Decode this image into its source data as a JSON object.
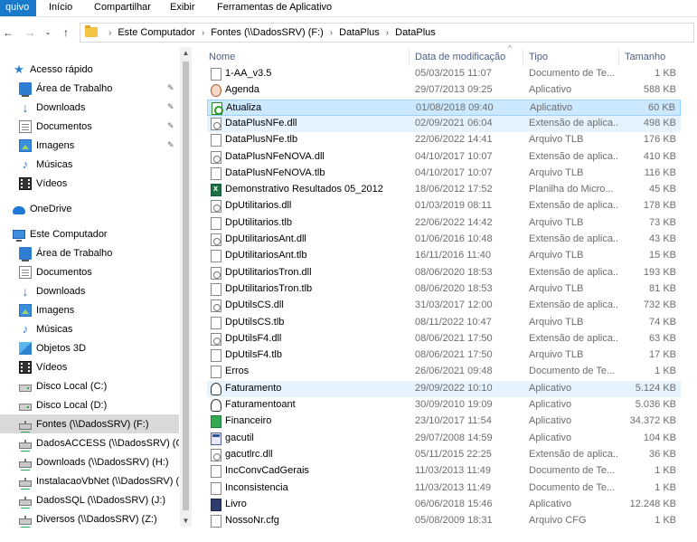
{
  "ribbon": {
    "file_tab": "quivo",
    "tabs": [
      "Início",
      "Compartilhar",
      "Exibir",
      "Ferramentas de Aplicativo"
    ]
  },
  "address": {
    "crumbs": [
      "Este Computador",
      "Fontes (\\\\DadosSRV) (F:)",
      "DataPlus",
      "DataPlus"
    ]
  },
  "nav": {
    "items": [
      {
        "label": "Acesso rápido",
        "icon": "star-icon",
        "indent": 0,
        "pinned": false
      },
      {
        "label": "Área de Trabalho",
        "icon": "desktop-icon",
        "indent": 1,
        "pinned": true
      },
      {
        "label": "Downloads",
        "icon": "download-icon",
        "indent": 1,
        "pinned": true
      },
      {
        "label": "Documentos",
        "icon": "documents-icon",
        "indent": 1,
        "pinned": true
      },
      {
        "label": "Imagens",
        "icon": "pictures-icon",
        "indent": 1,
        "pinned": true
      },
      {
        "label": "Músicas",
        "icon": "music-icon",
        "indent": 1,
        "pinned": false
      },
      {
        "label": "Vídeos",
        "icon": "videos-icon",
        "indent": 1,
        "pinned": false
      },
      {
        "label": "OneDrive",
        "icon": "cloud-icon",
        "indent": 0,
        "pinned": false
      },
      {
        "label": "Este Computador",
        "icon": "computer-icon",
        "indent": 0,
        "pinned": false
      },
      {
        "label": "Área de Trabalho",
        "icon": "desktop-icon",
        "indent": 1,
        "pinned": false
      },
      {
        "label": "Documentos",
        "icon": "documents-icon",
        "indent": 1,
        "pinned": false
      },
      {
        "label": "Downloads",
        "icon": "download-icon",
        "indent": 1,
        "pinned": false
      },
      {
        "label": "Imagens",
        "icon": "pictures-icon",
        "indent": 1,
        "pinned": false
      },
      {
        "label": "Músicas",
        "icon": "music-icon",
        "indent": 1,
        "pinned": false
      },
      {
        "label": "Objetos 3D",
        "icon": "3d-objects-icon",
        "indent": 1,
        "pinned": false
      },
      {
        "label": "Vídeos",
        "icon": "videos-icon",
        "indent": 1,
        "pinned": false
      },
      {
        "label": "Disco Local (C:)",
        "icon": "local-disk-icon",
        "indent": 1,
        "pinned": false
      },
      {
        "label": "Disco Local (D:)",
        "icon": "local-disk-icon",
        "indent": 1,
        "pinned": false
      },
      {
        "label": "Fontes (\\\\DadosSRV) (F:)",
        "icon": "network-drive-icon",
        "indent": 1,
        "pinned": false,
        "selected": true
      },
      {
        "label": "DadosACCESS (\\\\DadosSRV) (G:)",
        "icon": "network-drive-icon",
        "indent": 1,
        "pinned": false
      },
      {
        "label": "Downloads (\\\\DadosSRV) (H:)",
        "icon": "network-drive-icon",
        "indent": 1,
        "pinned": false
      },
      {
        "label": "InstalacaoVbNet (\\\\DadosSRV) (I:)",
        "icon": "network-drive-icon",
        "indent": 1,
        "pinned": false
      },
      {
        "label": "DadosSQL (\\\\DadosSRV) (J:)",
        "icon": "network-drive-icon",
        "indent": 1,
        "pinned": false
      },
      {
        "label": "Diversos (\\\\DadosSRV) (Z:)",
        "icon": "network-drive-icon",
        "indent": 1,
        "pinned": false
      }
    ]
  },
  "columns": {
    "name": "Nome",
    "date": "Data de modificação",
    "type": "Tipo",
    "size": "Tamanho"
  },
  "files": [
    {
      "name": "1-AA_v3.5",
      "date": "05/03/2015 11:07",
      "type": "Documento de Te...",
      "size": "1 KB",
      "icon": "generic"
    },
    {
      "name": "Agenda",
      "date": "29/07/2013 09:25",
      "type": "Aplicativo",
      "size": "588 KB",
      "icon": "agenda"
    },
    {
      "name": "Atualiza",
      "date": "01/08/2018 09:40",
      "type": "Aplicativo",
      "size": "60 KB",
      "icon": "atl",
      "state": "selected"
    },
    {
      "name": "DataPlusNFe.dll",
      "date": "02/09/2021 06:04",
      "type": "Extensão de aplica...",
      "size": "498 KB",
      "icon": "dll",
      "state": "hover"
    },
    {
      "name": "DataPlusNFe.tlb",
      "date": "22/06/2022 14:41",
      "type": "Arquivo TLB",
      "size": "176 KB",
      "icon": "generic"
    },
    {
      "name": "DataPlusNFeNOVA.dll",
      "date": "04/10/2017 10:07",
      "type": "Extensão de aplica...",
      "size": "410 KB",
      "icon": "dll"
    },
    {
      "name": "DataPlusNFeNOVA.tlb",
      "date": "04/10/2017 10:07",
      "type": "Arquivo TLB",
      "size": "116 KB",
      "icon": "generic"
    },
    {
      "name": "Demonstrativo Resultados 05_2012",
      "date": "18/06/2012 17:52",
      "type": "Planilha do Micro...",
      "size": "45 KB",
      "icon": "xls"
    },
    {
      "name": "DpUtilitarios.dll",
      "date": "01/03/2019 08:11",
      "type": "Extensão de aplica...",
      "size": "178 KB",
      "icon": "dll"
    },
    {
      "name": "DpUtilitarios.tlb",
      "date": "22/06/2022 14:42",
      "type": "Arquivo TLB",
      "size": "73 KB",
      "icon": "generic"
    },
    {
      "name": "DpUtilitariosAnt.dll",
      "date": "01/06/2016 10:48",
      "type": "Extensão de aplica...",
      "size": "43 KB",
      "icon": "dll"
    },
    {
      "name": "DpUtilitariosAnt.tlb",
      "date": "16/11/2016 11:40",
      "type": "Arquivo TLB",
      "size": "15 KB",
      "icon": "generic"
    },
    {
      "name": "DpUtilitariosTron.dll",
      "date": "08/06/2020 18:53",
      "type": "Extensão de aplica...",
      "size": "193 KB",
      "icon": "dll"
    },
    {
      "name": "DpUtilitariosTron.tlb",
      "date": "08/06/2020 18:53",
      "type": "Arquivo TLB",
      "size": "81 KB",
      "icon": "generic"
    },
    {
      "name": "DpUtilsCS.dll",
      "date": "31/03/2017 12:00",
      "type": "Extensão de aplica...",
      "size": "732 KB",
      "icon": "dll"
    },
    {
      "name": "DpUtilsCS.tlb",
      "date": "08/11/2022 10:47",
      "type": "Arquivo TLB",
      "size": "74 KB",
      "icon": "generic"
    },
    {
      "name": "DpUtilsF4.dll",
      "date": "08/06/2021 17:50",
      "type": "Extensão de aplica...",
      "size": "63 KB",
      "icon": "dll"
    },
    {
      "name": "DpUtilsF4.tlb",
      "date": "08/06/2021 17:50",
      "type": "Arquivo TLB",
      "size": "17 KB",
      "icon": "generic"
    },
    {
      "name": "Erros",
      "date": "26/06/2021 09:48",
      "type": "Documento de Te...",
      "size": "1 KB",
      "icon": "generic"
    },
    {
      "name": "Faturamento",
      "date": "29/09/2022 10:10",
      "type": "Aplicativo",
      "size": "5.124 KB",
      "icon": "face",
      "state": "hover"
    },
    {
      "name": "Faturamentoant",
      "date": "30/09/2010 19:09",
      "type": "Aplicativo",
      "size": "5.036 KB",
      "icon": "face"
    },
    {
      "name": "Financeiro",
      "date": "23/10/2017 11:54",
      "type": "Aplicativo",
      "size": "34.372 KB",
      "icon": "green"
    },
    {
      "name": "gacutil",
      "date": "29/07/2008 14:59",
      "type": "Aplicativo",
      "size": "104 KB",
      "icon": "app"
    },
    {
      "name": "gacutlrc.dll",
      "date": "05/11/2015 22:25",
      "type": "Extensão de aplica...",
      "size": "36 KB",
      "icon": "dll"
    },
    {
      "name": "IncConvCadGerais",
      "date": "11/03/2013 11:49",
      "type": "Documento de Te...",
      "size": "1 KB",
      "icon": "generic"
    },
    {
      "name": "Inconsistencia",
      "date": "11/03/2013 11:49",
      "type": "Documento de Te...",
      "size": "1 KB",
      "icon": "generic"
    },
    {
      "name": "Livro",
      "date": "06/06/2018 15:46",
      "type": "Aplicativo",
      "size": "12.248 KB",
      "icon": "book"
    },
    {
      "name": "NossoNr.cfg",
      "date": "05/08/2009 18:31",
      "type": "Arquivo CFG",
      "size": "1 KB",
      "icon": "generic"
    }
  ]
}
